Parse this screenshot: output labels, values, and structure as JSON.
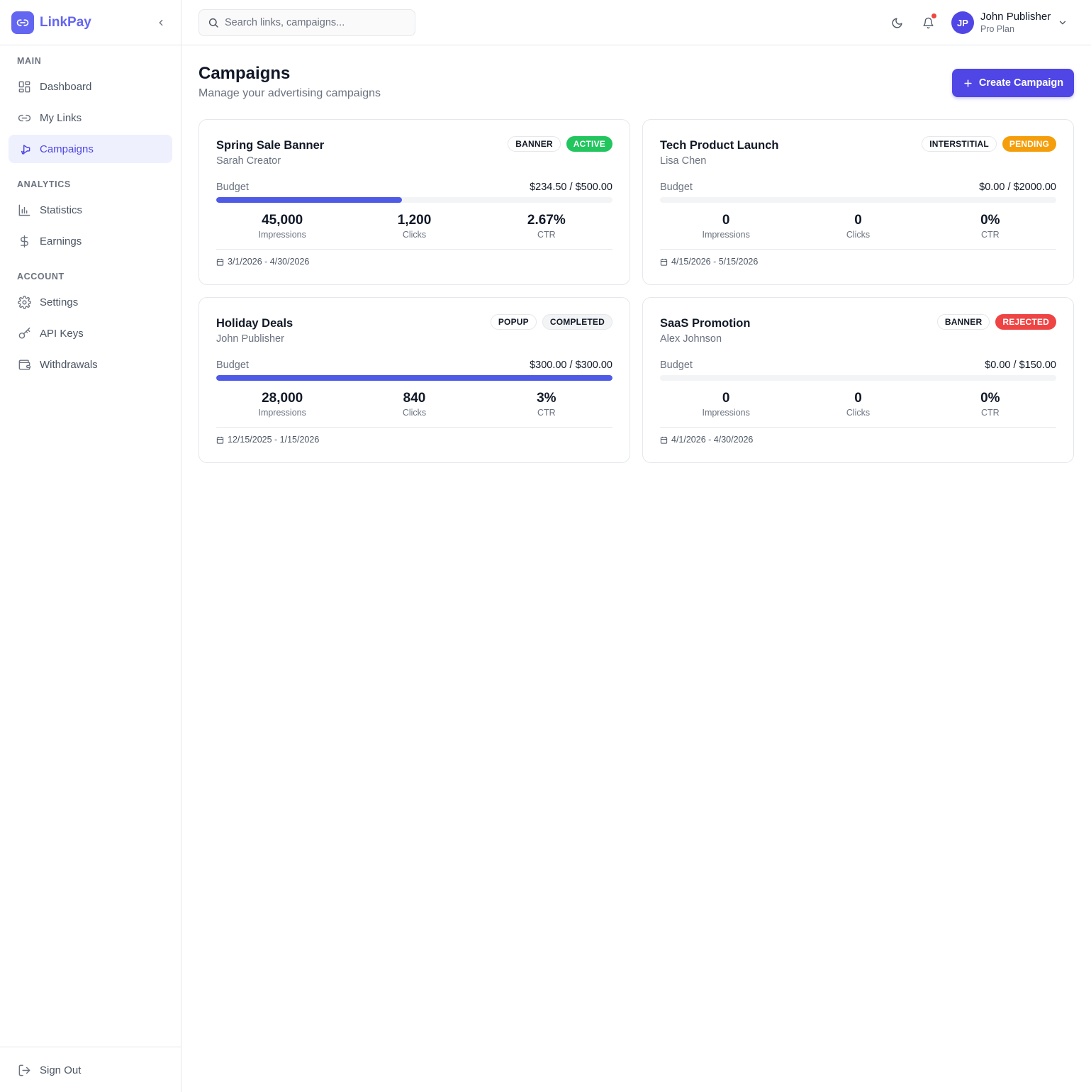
{
  "brand": {
    "name": "LinkPay",
    "accent": "#4f46e5"
  },
  "sidebar": {
    "sections": [
      {
        "heading": "MAIN",
        "items": [
          {
            "label": "Dashboard",
            "icon": "dashboard-icon",
            "active": false
          },
          {
            "label": "My Links",
            "icon": "link-icon",
            "active": false
          },
          {
            "label": "Campaigns",
            "icon": "megaphone-icon",
            "active": true
          }
        ]
      },
      {
        "heading": "ANALYTICS",
        "items": [
          {
            "label": "Statistics",
            "icon": "bar-chart-icon",
            "active": false
          },
          {
            "label": "Earnings",
            "icon": "dollar-icon",
            "active": false
          }
        ]
      },
      {
        "heading": "ACCOUNT",
        "items": [
          {
            "label": "Settings",
            "icon": "gear-icon",
            "active": false
          },
          {
            "label": "API Keys",
            "icon": "key-icon",
            "active": false
          },
          {
            "label": "Withdrawals",
            "icon": "wallet-icon",
            "active": false
          }
        ]
      }
    ],
    "signout_label": "Sign Out"
  },
  "topbar": {
    "search_placeholder": "Search links, campaigns...",
    "user": {
      "initials": "JP",
      "name": "John Publisher",
      "plan": "Pro Plan"
    }
  },
  "page": {
    "title": "Campaigns",
    "subtitle": "Manage your advertising campaigns",
    "create_label": "Create Campaign"
  },
  "campaigns": [
    {
      "title": "Spring Sale Banner",
      "owner": "Sarah Creator",
      "type": "BANNER",
      "status": "ACTIVE",
      "status_color": "#22c55e",
      "budget_label": "Budget",
      "budget": "$234.50 / $500.00",
      "progress": 0.469,
      "impressions": "45,000",
      "clicks": "1,200",
      "ctr": "2.67%",
      "impressions_label": "Impressions",
      "clicks_label": "Clicks",
      "ctr_label": "CTR",
      "dates": "3/1/2026 - 4/30/2026"
    },
    {
      "title": "Tech Product Launch",
      "owner": "Lisa Chen",
      "type": "INTERSTITIAL",
      "status": "PENDING",
      "status_color": "#f59e0b",
      "budget_label": "Budget",
      "budget": "$0.00 / $2000.00",
      "progress": 0,
      "impressions": "0",
      "clicks": "0",
      "ctr": "0%",
      "impressions_label": "Impressions",
      "clicks_label": "Clicks",
      "ctr_label": "CTR",
      "dates": "4/15/2026 - 5/15/2026"
    },
    {
      "title": "Holiday Deals",
      "owner": "John Publisher",
      "type": "POPUP",
      "status": "COMPLETED",
      "status_color": "#f3f4f6",
      "budget_label": "Budget",
      "budget": "$300.00 / $300.00",
      "progress": 1.0,
      "impressions": "28,000",
      "clicks": "840",
      "ctr": "3%",
      "impressions_label": "Impressions",
      "clicks_label": "Clicks",
      "ctr_label": "CTR",
      "dates": "12/15/2025 - 1/15/2026"
    },
    {
      "title": "SaaS Promotion",
      "owner": "Alex Johnson",
      "type": "BANNER",
      "status": "REJECTED",
      "status_color": "#ef4444",
      "budget_label": "Budget",
      "budget": "$0.00 / $150.00",
      "progress": 0,
      "impressions": "0",
      "clicks": "0",
      "ctr": "0%",
      "impressions_label": "Impressions",
      "clicks_label": "Clicks",
      "ctr_label": "CTR",
      "dates": "4/1/2026 - 4/30/2026"
    }
  ]
}
